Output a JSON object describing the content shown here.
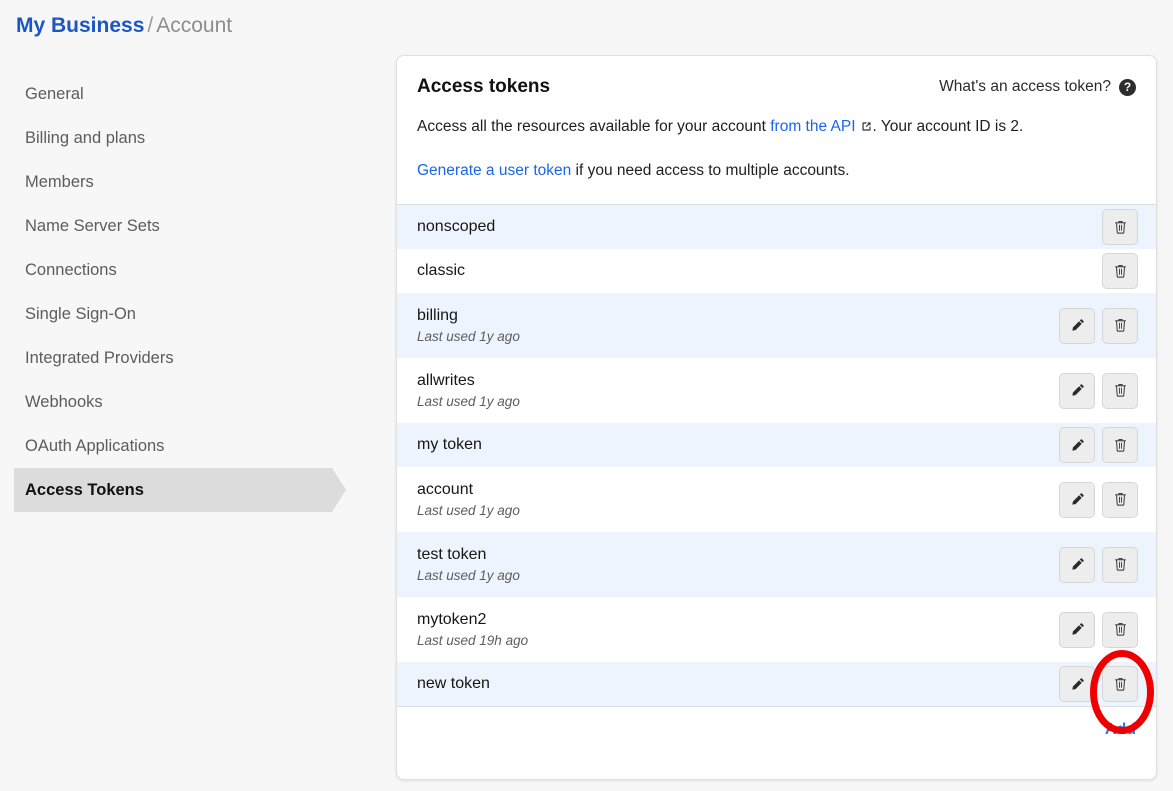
{
  "breadcrumb": {
    "root": "My Business",
    "separator": "/",
    "current": "Account"
  },
  "sidebar": {
    "items": [
      {
        "label": "General",
        "active": false
      },
      {
        "label": "Billing and plans",
        "active": false
      },
      {
        "label": "Members",
        "active": false
      },
      {
        "label": "Name Server Sets",
        "active": false
      },
      {
        "label": "Connections",
        "active": false
      },
      {
        "label": "Single Sign-On",
        "active": false
      },
      {
        "label": "Integrated Providers",
        "active": false
      },
      {
        "label": "Webhooks",
        "active": false
      },
      {
        "label": "OAuth Applications",
        "active": false
      },
      {
        "label": "Access Tokens",
        "active": true
      }
    ]
  },
  "card": {
    "title": "Access tokens",
    "help": {
      "label": "What's an access token?",
      "icon": "question-mark-circle-icon"
    },
    "description": {
      "part1": "Access all the resources available for your account ",
      "api_link": "from the API",
      "external_icon": "external-link-icon",
      "part2": ". Your account ID is 2.",
      "generate_link": "Generate a user token",
      "part3": " if you need access to multiple accounts."
    },
    "add_label": "Add",
    "edit_icon": "pencil-icon",
    "delete_icon": "trash-icon",
    "tokens": [
      {
        "name": "nonscoped",
        "last_used": "",
        "can_edit": false
      },
      {
        "name": "classic",
        "last_used": "",
        "can_edit": false
      },
      {
        "name": "billing",
        "last_used": "Last used 1y ago",
        "can_edit": true
      },
      {
        "name": "allwrites",
        "last_used": "Last used 1y ago",
        "can_edit": true
      },
      {
        "name": "my token",
        "last_used": "",
        "can_edit": true
      },
      {
        "name": "account",
        "last_used": "Last used 1y ago",
        "can_edit": true
      },
      {
        "name": "test token",
        "last_used": "Last used 1y ago",
        "can_edit": true
      },
      {
        "name": "mytoken2",
        "last_used": "Last used 19h ago",
        "can_edit": true
      },
      {
        "name": "new token",
        "last_used": "",
        "can_edit": true
      }
    ]
  },
  "annotation": {
    "shape": "red-ellipse-highlight",
    "target": "delete-button-new-token",
    "color": "#ee0000"
  },
  "colors": {
    "accent_blue": "#1a56c4",
    "link_blue": "#1a66e8",
    "add_blue": "#3b76e0",
    "row_alt": "#eef4fd",
    "page_bg": "#f7f7f8",
    "active_nav_bg": "#dcdcdc"
  }
}
